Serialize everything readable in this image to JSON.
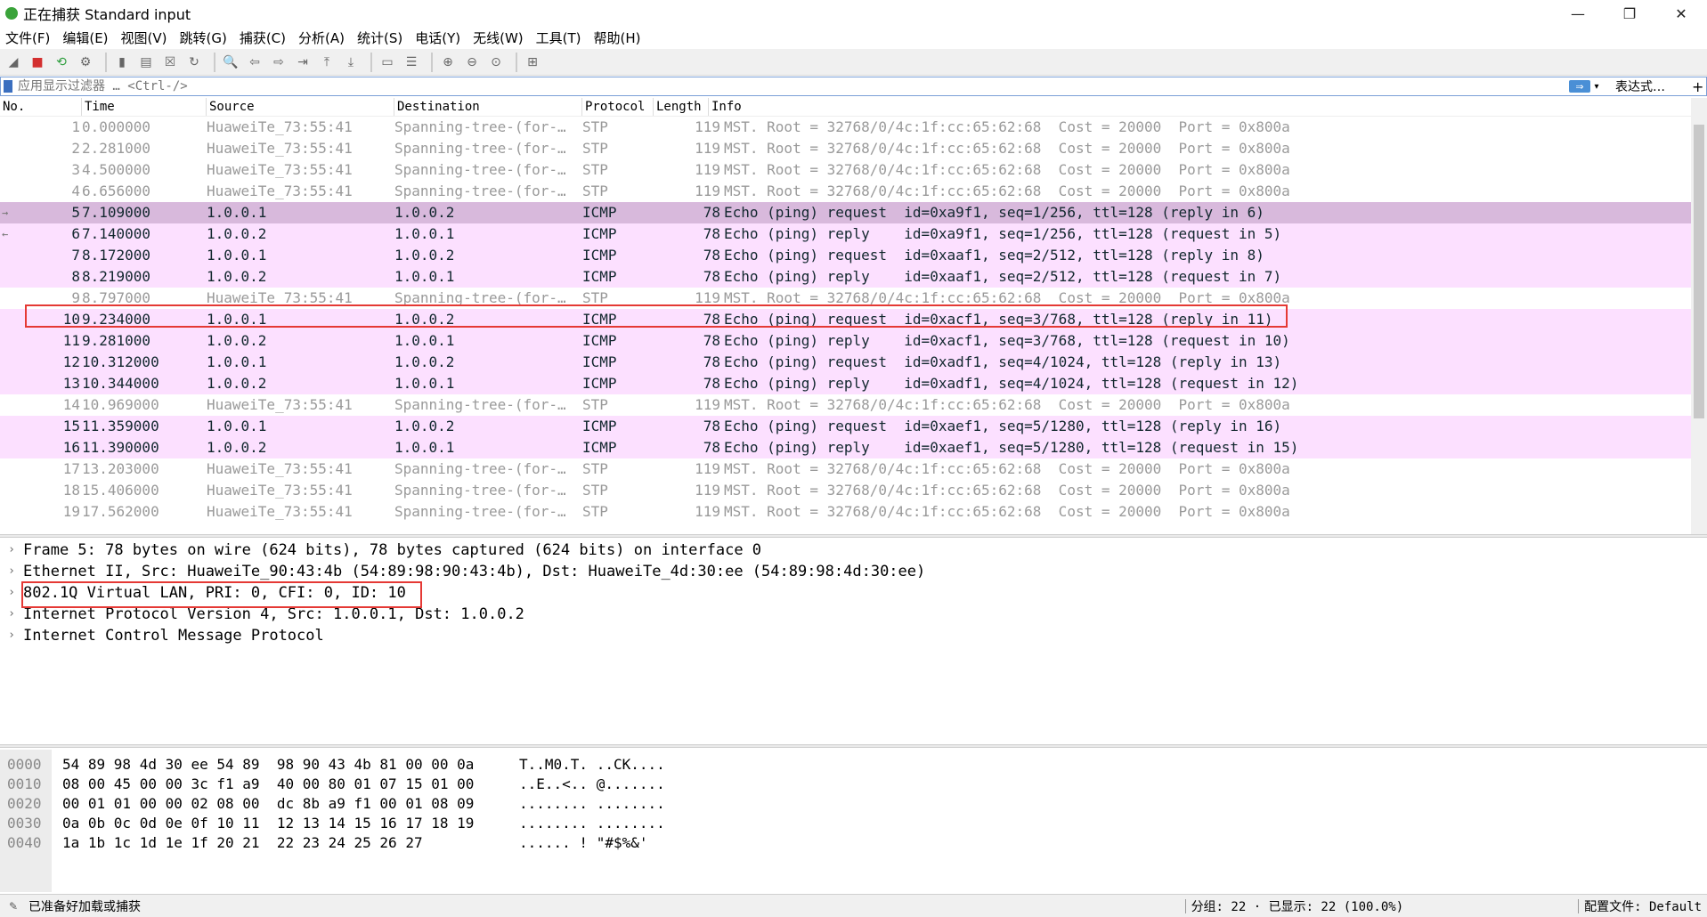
{
  "window": {
    "title": "正在捕获 Standard input",
    "minimize": "—",
    "maximize": "❐",
    "close": "✕"
  },
  "menu": [
    "文件(F)",
    "编辑(E)",
    "视图(V)",
    "跳转(G)",
    "捕获(C)",
    "分析(A)",
    "统计(S)",
    "电话(Y)",
    "无线(W)",
    "工具(T)",
    "帮助(H)"
  ],
  "toolbar": {
    "icons": [
      "shark-fin-start-icon",
      "stop-capture-icon",
      "restart-capture-icon",
      "capture-options-icon",
      "open-file-icon",
      "save-file-icon",
      "close-file-icon",
      "reload-icon",
      "find-packet-icon",
      "go-back-icon",
      "go-forward-icon",
      "go-to-packet-icon",
      "go-first-icon",
      "go-last-icon",
      "auto-scroll-icon",
      "colorize-icon",
      "zoom-in-icon",
      "zoom-out-icon",
      "zoom-normal-icon",
      "resize-columns-icon"
    ],
    "glyphs": [
      "◢",
      "■",
      "⟲",
      "⚙",
      "▮",
      "▤",
      "☒",
      "↻",
      "🔍",
      "⇦",
      "⇨",
      "⇥",
      "⤒",
      "⤓",
      "▭",
      "☰",
      "⊕",
      "⊖",
      "⊙",
      "⊞"
    ]
  },
  "filter": {
    "placeholder": "应用显示过滤器 … <Ctrl-/>",
    "apply": "⇒",
    "expression": "表达式…",
    "add": "+"
  },
  "packet_list": {
    "headers": {
      "no": "No.",
      "time": "Time",
      "source": "Source",
      "destination": "Destination",
      "protocol": "Protocol",
      "length": "Length",
      "info": "Info"
    },
    "rows": [
      {
        "no": "1",
        "time": "0.000000",
        "source": "HuaweiTe_73:55:41",
        "destination": "Spanning-tree-(for-…",
        "protocol": "STP",
        "length": "119",
        "info": "MST. Root = 32768/0/4c:1f:cc:65:62:68  Cost = 20000  Port = 0x800a",
        "type": "stp"
      },
      {
        "no": "2",
        "time": "2.281000",
        "source": "HuaweiTe_73:55:41",
        "destination": "Spanning-tree-(for-…",
        "protocol": "STP",
        "length": "119",
        "info": "MST. Root = 32768/0/4c:1f:cc:65:62:68  Cost = 20000  Port = 0x800a",
        "type": "stp"
      },
      {
        "no": "3",
        "time": "4.500000",
        "source": "HuaweiTe_73:55:41",
        "destination": "Spanning-tree-(for-…",
        "protocol": "STP",
        "length": "119",
        "info": "MST. Root = 32768/0/4c:1f:cc:65:62:68  Cost = 20000  Port = 0x800a",
        "type": "stp"
      },
      {
        "no": "4",
        "time": "6.656000",
        "source": "HuaweiTe_73:55:41",
        "destination": "Spanning-tree-(for-…",
        "protocol": "STP",
        "length": "119",
        "info": "MST. Root = 32768/0/4c:1f:cc:65:62:68  Cost = 20000  Port = 0x800a",
        "type": "stp"
      },
      {
        "no": "5",
        "time": "7.109000",
        "source": "1.0.0.1",
        "destination": "1.0.0.2",
        "protocol": "ICMP",
        "length": "78",
        "info": "Echo (ping) request  id=0xa9f1, seq=1/256, ttl=128 (reply in 6)",
        "type": "icmp",
        "selected": true,
        "marker": "→"
      },
      {
        "no": "6",
        "time": "7.140000",
        "source": "1.0.0.2",
        "destination": "1.0.0.1",
        "protocol": "ICMP",
        "length": "78",
        "info": "Echo (ping) reply    id=0xa9f1, seq=1/256, ttl=128 (request in 5)",
        "type": "icmp",
        "marker": "←"
      },
      {
        "no": "7",
        "time": "8.172000",
        "source": "1.0.0.1",
        "destination": "1.0.0.2",
        "protocol": "ICMP",
        "length": "78",
        "info": "Echo (ping) request  id=0xaaf1, seq=2/512, ttl=128 (reply in 8)",
        "type": "icmp"
      },
      {
        "no": "8",
        "time": "8.219000",
        "source": "1.0.0.2",
        "destination": "1.0.0.1",
        "protocol": "ICMP",
        "length": "78",
        "info": "Echo (ping) reply    id=0xaaf1, seq=2/512, ttl=128 (request in 7)",
        "type": "icmp"
      },
      {
        "no": "9",
        "time": "8.797000",
        "source": "HuaweiTe_73:55:41",
        "destination": "Spanning-tree-(for-…",
        "protocol": "STP",
        "length": "119",
        "info": "MST. Root = 32768/0/4c:1f:cc:65:62:68  Cost = 20000  Port = 0x800a",
        "type": "stp"
      },
      {
        "no": "10",
        "time": "9.234000",
        "source": "1.0.0.1",
        "destination": "1.0.0.2",
        "protocol": "ICMP",
        "length": "78",
        "info": "Echo (ping) request  id=0xacf1, seq=3/768, ttl=128 (reply in 11)",
        "type": "icmp"
      },
      {
        "no": "11",
        "time": "9.281000",
        "source": "1.0.0.2",
        "destination": "1.0.0.1",
        "protocol": "ICMP",
        "length": "78",
        "info": "Echo (ping) reply    id=0xacf1, seq=3/768, ttl=128 (request in 10)",
        "type": "icmp"
      },
      {
        "no": "12",
        "time": "10.312000",
        "source": "1.0.0.1",
        "destination": "1.0.0.2",
        "protocol": "ICMP",
        "length": "78",
        "info": "Echo (ping) request  id=0xadf1, seq=4/1024, ttl=128 (reply in 13)",
        "type": "icmp"
      },
      {
        "no": "13",
        "time": "10.344000",
        "source": "1.0.0.2",
        "destination": "1.0.0.1",
        "protocol": "ICMP",
        "length": "78",
        "info": "Echo (ping) reply    id=0xadf1, seq=4/1024, ttl=128 (request in 12)",
        "type": "icmp"
      },
      {
        "no": "14",
        "time": "10.969000",
        "source": "HuaweiTe_73:55:41",
        "destination": "Spanning-tree-(for-…",
        "protocol": "STP",
        "length": "119",
        "info": "MST. Root = 32768/0/4c:1f:cc:65:62:68  Cost = 20000  Port = 0x800a",
        "type": "stp"
      },
      {
        "no": "15",
        "time": "11.359000",
        "source": "1.0.0.1",
        "destination": "1.0.0.2",
        "protocol": "ICMP",
        "length": "78",
        "info": "Echo (ping) request  id=0xaef1, seq=5/1280, ttl=128 (reply in 16)",
        "type": "icmp"
      },
      {
        "no": "16",
        "time": "11.390000",
        "source": "1.0.0.2",
        "destination": "1.0.0.1",
        "protocol": "ICMP",
        "length": "78",
        "info": "Echo (ping) reply    id=0xaef1, seq=5/1280, ttl=128 (request in 15)",
        "type": "icmp"
      },
      {
        "no": "17",
        "time": "13.203000",
        "source": "HuaweiTe_73:55:41",
        "destination": "Spanning-tree-(for-…",
        "protocol": "STP",
        "length": "119",
        "info": "MST. Root = 32768/0/4c:1f:cc:65:62:68  Cost = 20000  Port = 0x800a",
        "type": "stp"
      },
      {
        "no": "18",
        "time": "15.406000",
        "source": "HuaweiTe_73:55:41",
        "destination": "Spanning-tree-(for-…",
        "protocol": "STP",
        "length": "119",
        "info": "MST. Root = 32768/0/4c:1f:cc:65:62:68  Cost = 20000  Port = 0x800a",
        "type": "stp"
      },
      {
        "no": "19",
        "time": "17.562000",
        "source": "HuaweiTe_73:55:41",
        "destination": "Spanning-tree-(for-…",
        "protocol": "STP",
        "length": "119",
        "info": "MST. Root = 32768/0/4c:1f:cc:65:62:68  Cost = 20000  Port = 0x800a",
        "type": "stp"
      }
    ],
    "colors": {
      "icmp_bg": "#fce0ff",
      "selected_bg": "#d8b9dc",
      "stp_text": "#9a9a9a",
      "highlight_border": "#e53935"
    }
  },
  "details": [
    "Frame 5: 78 bytes on wire (624 bits), 78 bytes captured (624 bits) on interface 0",
    "Ethernet II, Src: HuaweiTe_90:43:4b (54:89:98:90:43:4b), Dst: HuaweiTe_4d:30:ee (54:89:98:4d:30:ee)",
    "802.1Q Virtual LAN, PRI: 0, CFI: 0, ID: 10",
    "Internet Protocol Version 4, Src: 1.0.0.1, Dst: 1.0.0.2",
    "Internet Control Message Protocol"
  ],
  "details_chevron": "›",
  "hex": [
    {
      "off": "0000",
      "bytes": "54 89 98 4d 30 ee 54 89  98 90 43 4b 81 00 00 0a",
      "ascii": "T..M0.T. ..CK...."
    },
    {
      "off": "0010",
      "bytes": "08 00 45 00 00 3c f1 a9  40 00 80 01 07 15 01 00",
      "ascii": "..E..<.. @......."
    },
    {
      "off": "0020",
      "bytes": "00 01 01 00 00 02 08 00  dc 8b a9 f1 00 01 08 09",
      "ascii": "........ ........"
    },
    {
      "off": "0030",
      "bytes": "0a 0b 0c 0d 0e 0f 10 11  12 13 14 15 16 17 18 19",
      "ascii": "........ ........"
    },
    {
      "off": "0040",
      "bytes": "1a 1b 1c 1d 1e 1f 20 21  22 23 24 25 26 27",
      "ascii": "...... ! \"#$%&'"
    }
  ],
  "status": {
    "icon": "✎",
    "text": "已准备好加载或捕获",
    "packets": "分组: 22 · 已显示: 22 (100.0%)",
    "profile": "配置文件: Default"
  }
}
